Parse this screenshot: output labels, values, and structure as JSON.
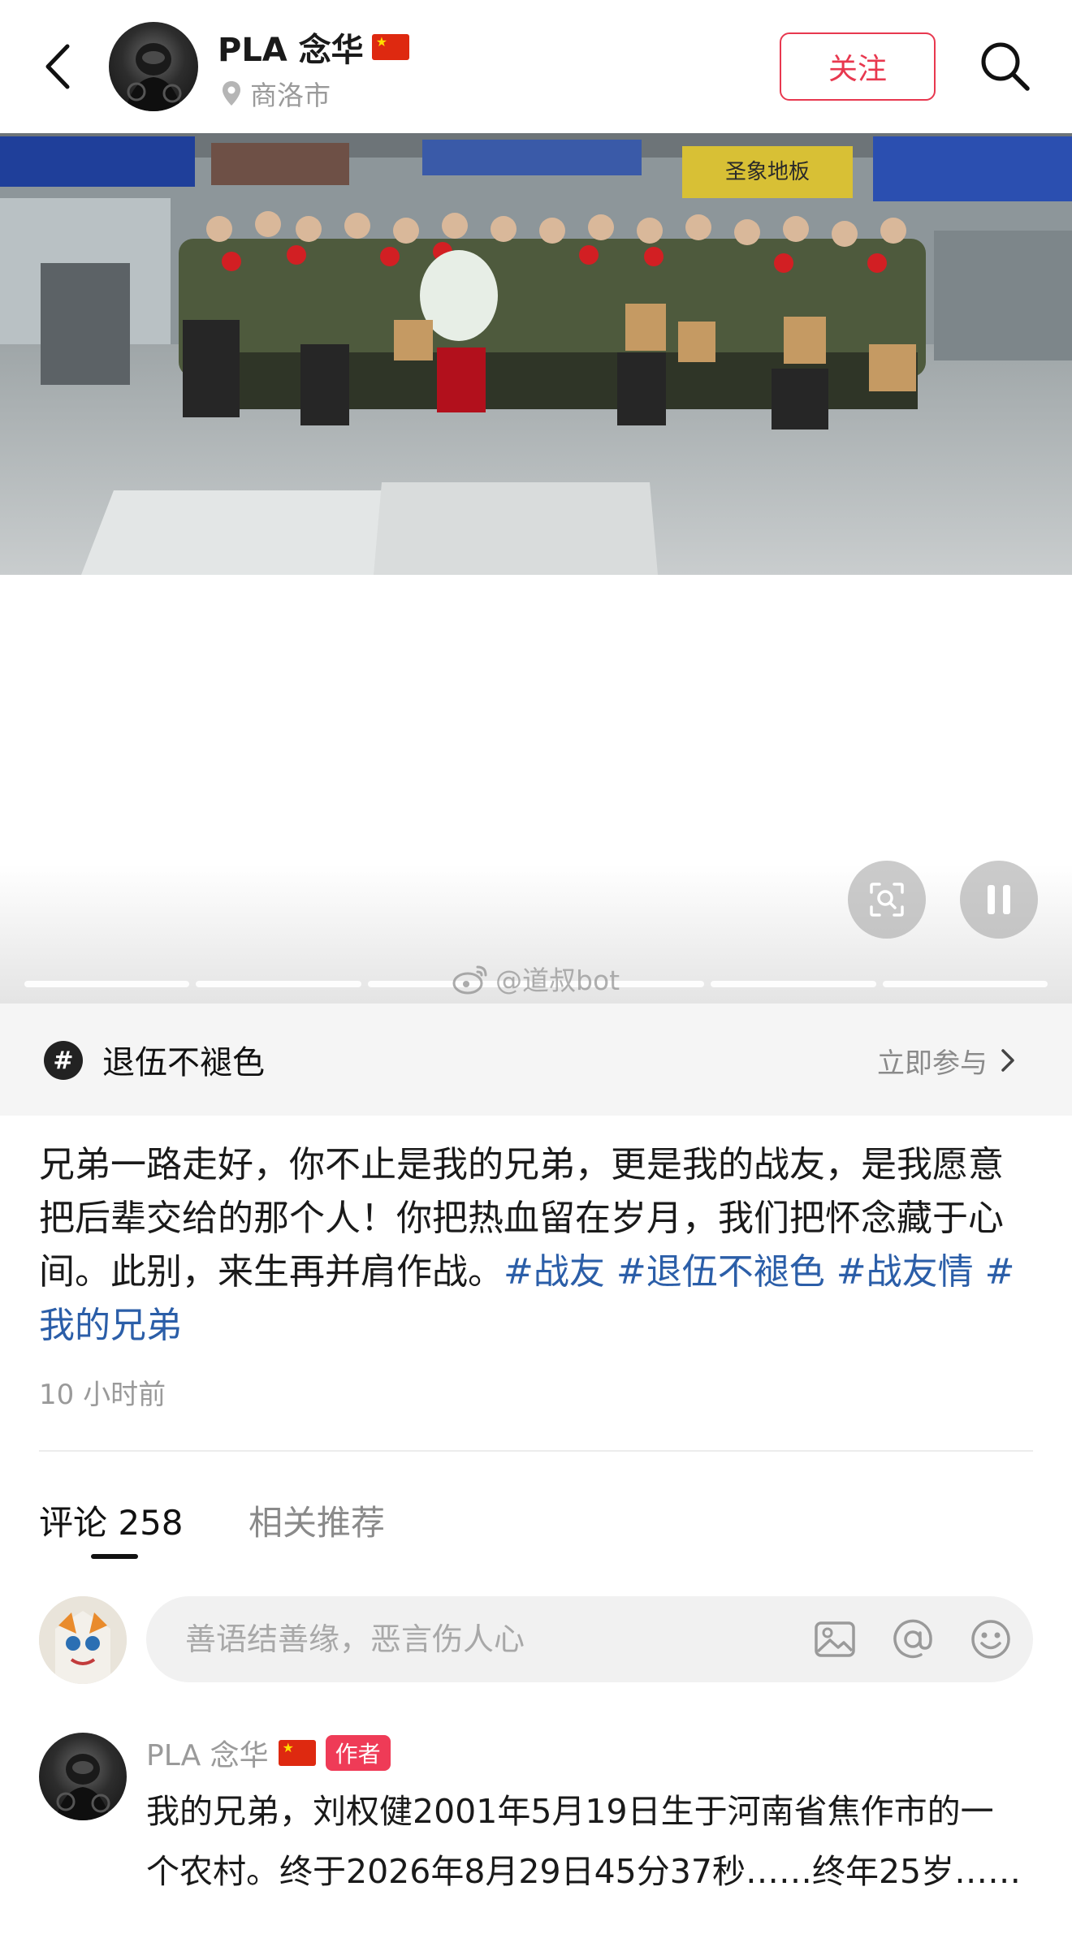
{
  "header": {
    "author_name": "PLA 念华",
    "location": "商洛市",
    "follow_label": "关注"
  },
  "video": {
    "watermark": "@道叔bot",
    "progress_segments": 6
  },
  "topic": {
    "name": "退伍不褪色",
    "join_label": "立即参与"
  },
  "post": {
    "caption_text": "兄弟一路走好，你不止是我的兄弟，更是我的战友，是我愿意把后辈交给的那个人！你把热血留在岁月，我们把怀念藏于心间。此别，来生再并肩作战。",
    "hashtags": [
      "#战友",
      "#退伍不褪色",
      "#战友情",
      "#我的兄弟"
    ],
    "time": "10 小时前"
  },
  "tabs": {
    "comments_label": "评论 258",
    "related_label": "相关推荐"
  },
  "comment_input": {
    "placeholder": "善语结善缘，恶言伤人心"
  },
  "comments": [
    {
      "author": "PLA 念华",
      "badge": "作者",
      "text": "我的兄弟，刘权健2001年5月19日生于河南省焦作市的一个农村。终于2026年8月29日45分37秒……终年25岁……"
    }
  ],
  "colors": {
    "accent": "#e8384f",
    "hashtag": "#2b5ea8",
    "author_badge": "#ef3b57"
  },
  "icons": [
    "back-arrow-icon",
    "location-pin-icon",
    "search-icon",
    "screen-recognize-icon",
    "pause-icon",
    "hashtag-icon",
    "chevron-right-icon",
    "image-icon",
    "at-mention-icon",
    "emoji-icon",
    "weibo-logo-icon"
  ]
}
